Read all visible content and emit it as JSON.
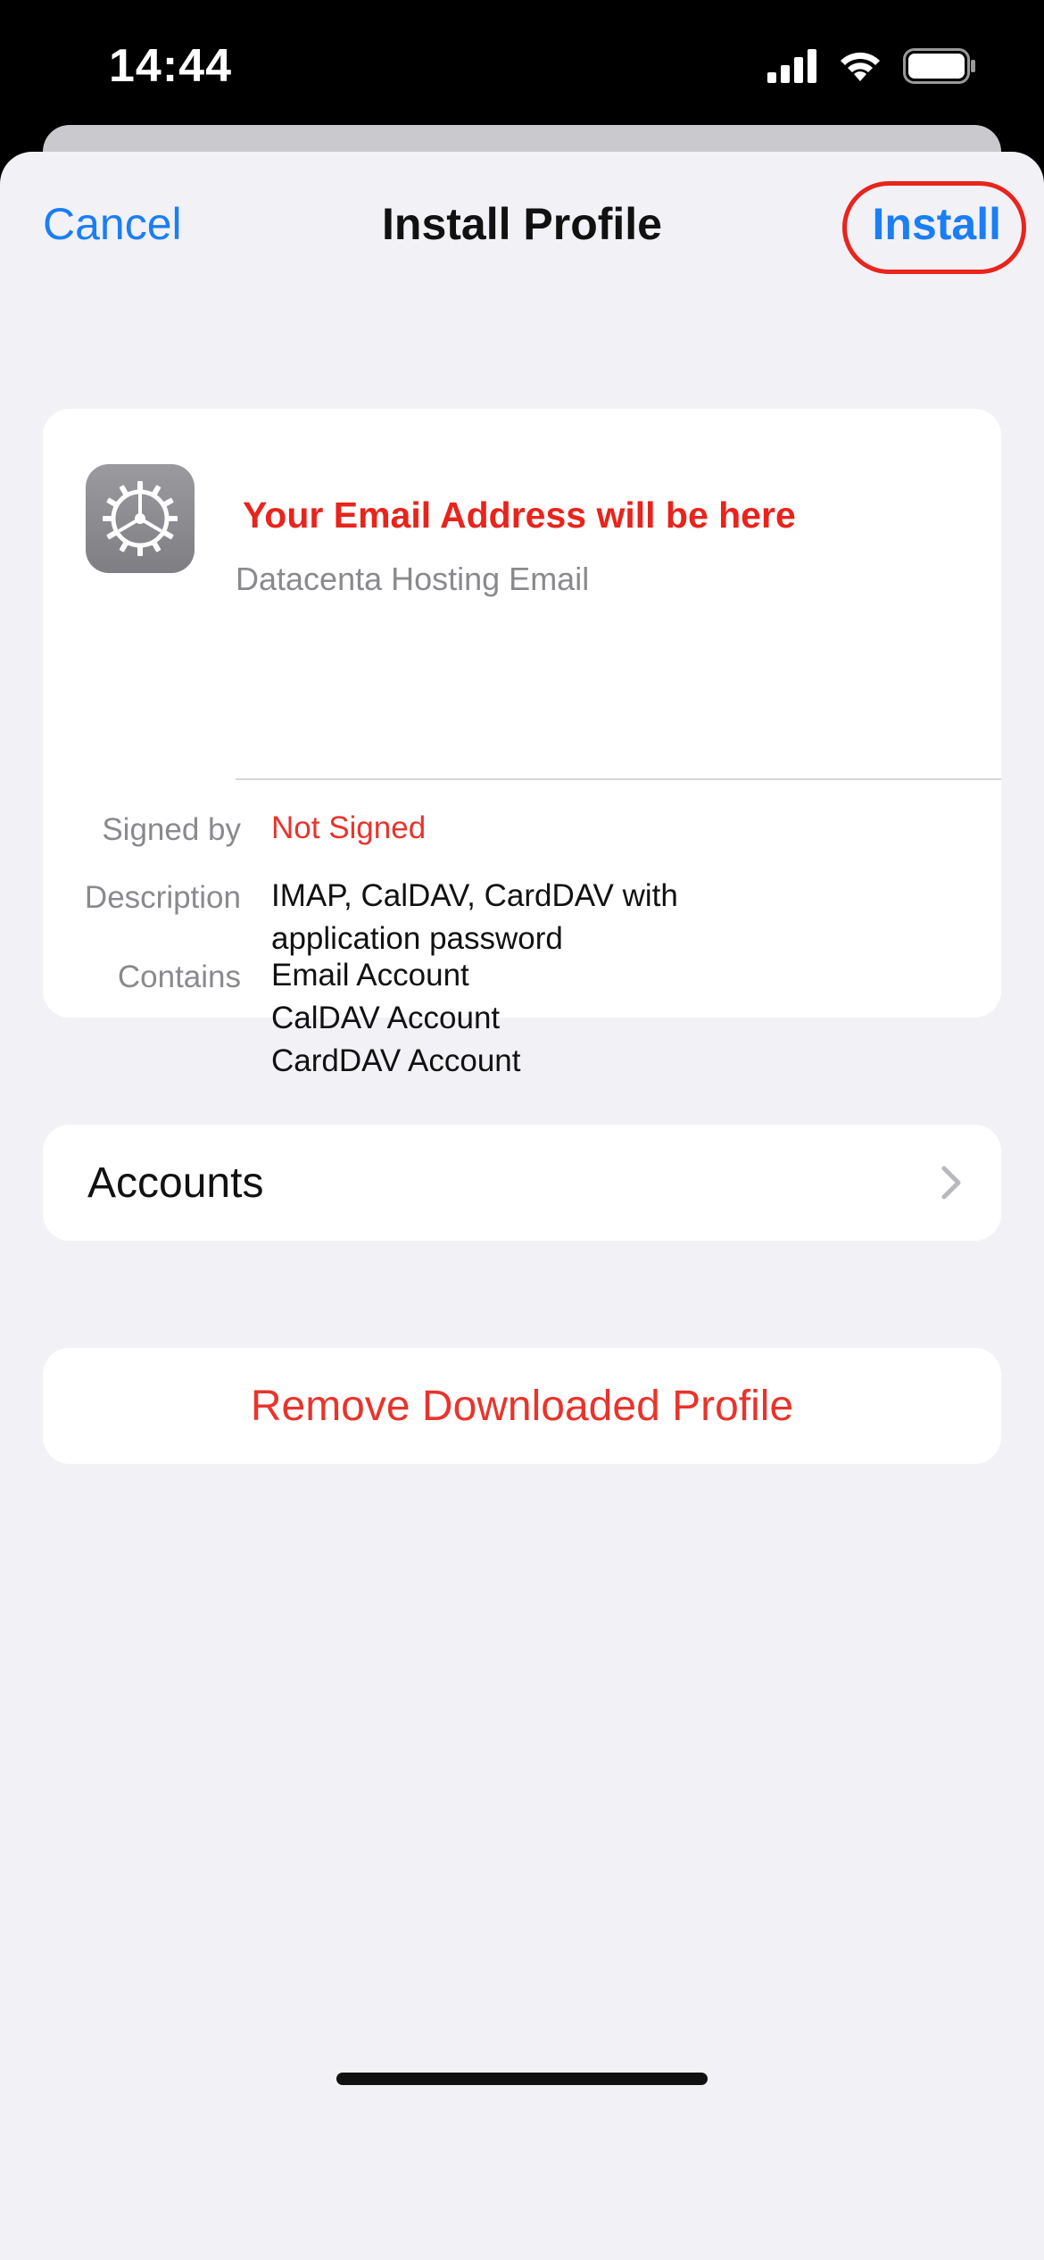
{
  "status_bar": {
    "time": "14:44",
    "icons": [
      "cellular-signal-icon",
      "wifi-icon",
      "battery-icon"
    ]
  },
  "nav": {
    "cancel_label": "Cancel",
    "title": "Install Profile",
    "install_label": "Install"
  },
  "profile": {
    "icon": "settings-gear-icon",
    "name": "Your Email Address will be here",
    "subtitle": "Datacenta Hosting Email",
    "details": [
      {
        "label": "Signed by",
        "value": "Not Signed"
      },
      {
        "label": "Description",
        "value": "IMAP, CalDAV, CardDAV with\napplication password"
      },
      {
        "label": "Contains",
        "value": "Email Account\nCalDAV Account\nCardDAV Account"
      }
    ]
  },
  "accounts": {
    "label": "Accounts"
  },
  "remove": {
    "label": "Remove Downloaded Profile"
  },
  "colors": {
    "accent_blue": "#1a7ef5",
    "destructive_red": "#e8342c",
    "highlight_red": "#e8241c",
    "background": "#f2f1f6",
    "card": "#ffffff"
  }
}
